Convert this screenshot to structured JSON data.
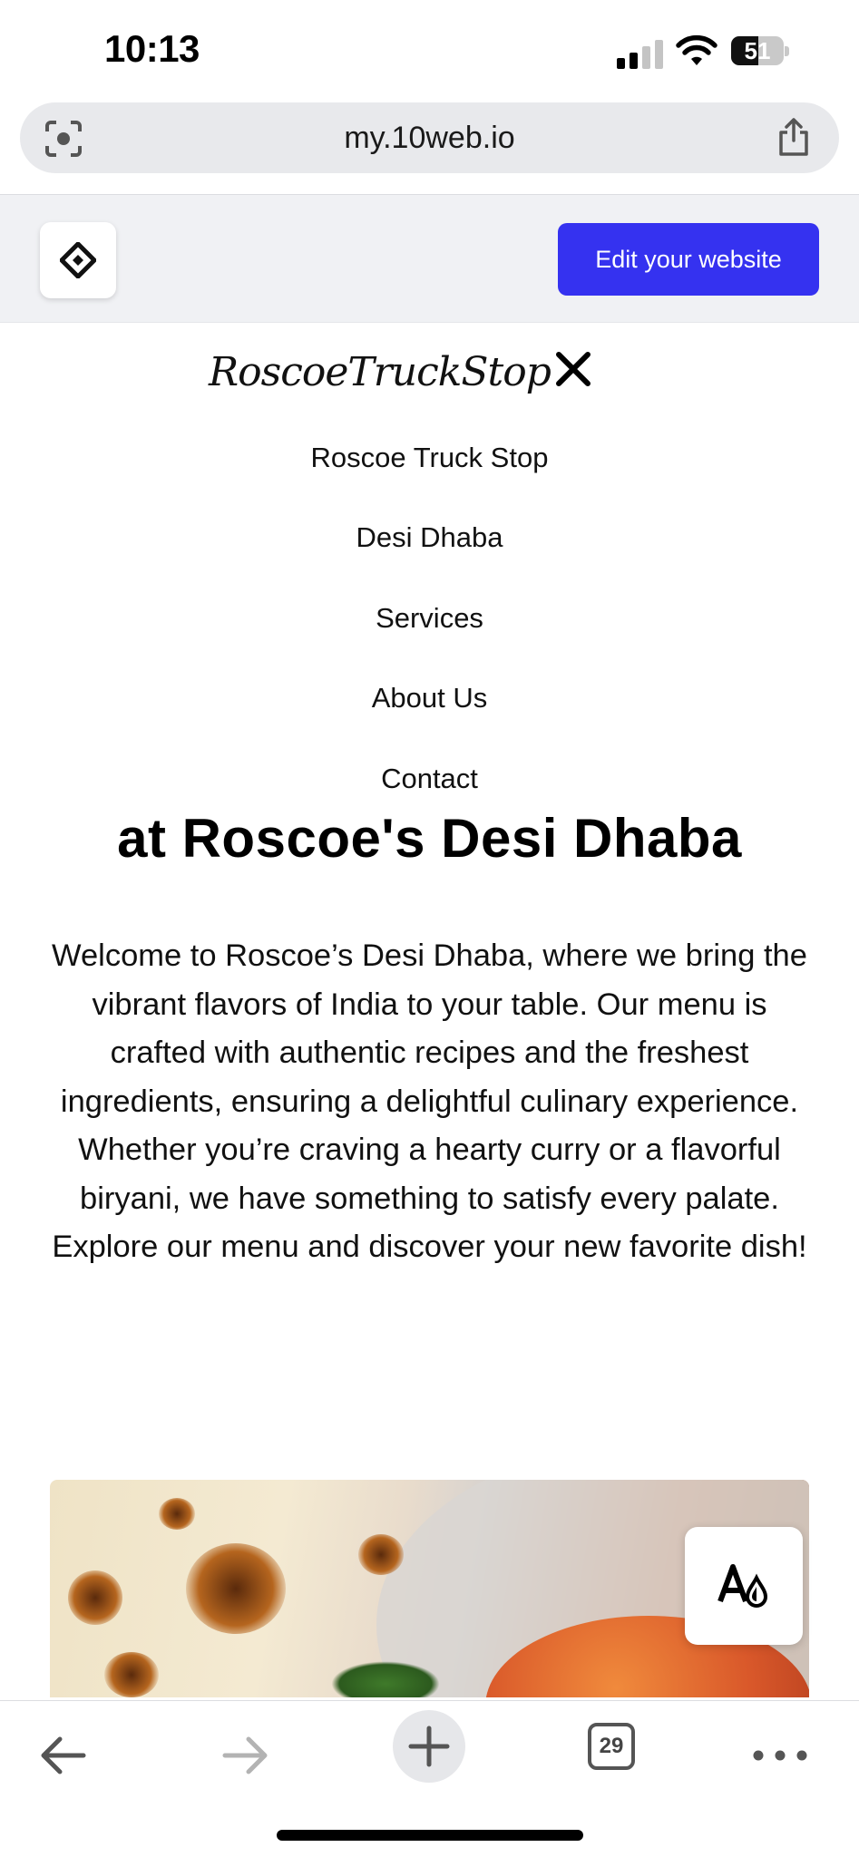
{
  "status_bar": {
    "time": "10:13",
    "battery_level": "51",
    "signal_bars": 2,
    "icons": [
      "cellular-signal-icon",
      "wifi-icon",
      "battery-icon"
    ]
  },
  "browser": {
    "url": "my.10web.io",
    "lens_icon": "camera-search-icon",
    "share_icon": "share-icon",
    "tab_count": "29"
  },
  "editor": {
    "edit_button_label": "Edit your website",
    "accent_color": "#3532f0",
    "logo_icon": "10web-logo-icon"
  },
  "site": {
    "brand": "RoscoeTruckStop",
    "menu_items": [
      "Roscoe Truck Stop",
      "Desi Dhaba",
      "Services",
      "About Us",
      "Contact"
    ],
    "headline": "at Roscoe's Desi Dhaba",
    "intro": "Welcome to Roscoe’s Desi Dhaba, where we bring the vibrant flavors of India to your table. Our menu is crafted with authentic recipes and the freshest ingredients, ensuring a delightful culinary experience. Whether you’re craving a hearty curry or a flavorful biryani, we have something to satisfy every palate. Explore our menu and discover your new favorite dish!"
  }
}
